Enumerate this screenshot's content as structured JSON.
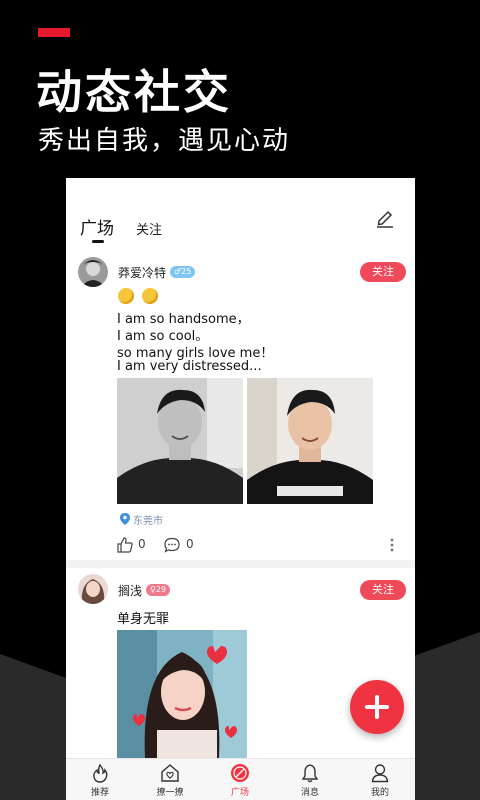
{
  "promo": {
    "title": "动态社交",
    "subtitle": "秀出自我，遇见心动"
  },
  "tabs": {
    "active": "广场",
    "other": "关注"
  },
  "posts": [
    {
      "username": "莽爱冷特",
      "badge": "♂25",
      "badge_color": "#7fc6f0",
      "follow_label": "关注",
      "lines": [
        "I am so handsome，",
        "I am so cool。",
        "so many girls love me！",
        " I am very distressed..."
      ],
      "location": "东莞市",
      "likes": "0",
      "comments": "0"
    },
    {
      "username": "搁浅",
      "badge": "♀29",
      "badge_color": "#f07a8c",
      "follow_label": "关注",
      "lines": [
        "单身无罪"
      ]
    }
  ],
  "nav": [
    {
      "label": "推荐",
      "icon": "flame-icon"
    },
    {
      "label": "撩一撩",
      "icon": "home-heart-icon"
    },
    {
      "label": "广场",
      "icon": "compass-icon"
    },
    {
      "label": "消息",
      "icon": "bell-icon"
    },
    {
      "label": "我的",
      "icon": "person-icon"
    }
  ],
  "colors": {
    "accent": "#ef3340",
    "follow": "#f0495a",
    "location": "#7a8fb3"
  }
}
